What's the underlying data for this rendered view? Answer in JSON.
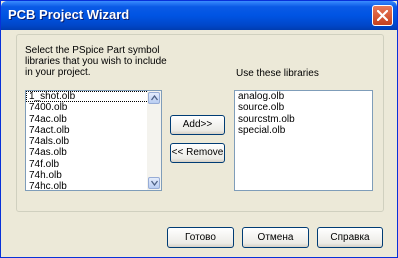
{
  "window": {
    "title": "PCB Project Wizard"
  },
  "instructions": "Select the PSpice Part symbol\nlibraries that you wish to include\nin your project.",
  "available": {
    "items": [
      "1_shot.olb",
      "7400.olb",
      "74ac.olb",
      "74act.olb",
      "74als.olb",
      "74as.olb",
      "74f.olb",
      "74h.olb",
      "74hc.olb"
    ],
    "selected_index": 0
  },
  "used": {
    "label": "Use these libraries",
    "items": [
      "analog.olb",
      "source.olb",
      "sourcstm.olb",
      "special.olb"
    ]
  },
  "buttons": {
    "add": "Add>>",
    "remove": "<< Remove",
    "ok": "Готово",
    "cancel": "Отмена",
    "help": "Справка"
  },
  "colors": {
    "title_bar": "#0054e3",
    "dialog_bg": "#ece9d8",
    "close_button": "#d1562f"
  },
  "icons": [
    "close-icon",
    "scroll-up-arrow-icon",
    "scroll-down-arrow-icon"
  ]
}
